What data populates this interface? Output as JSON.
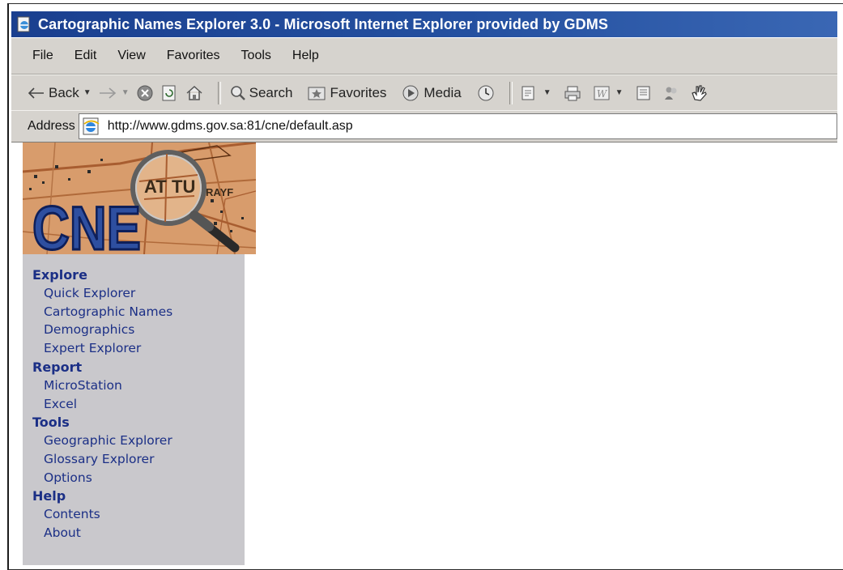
{
  "window": {
    "title": "Cartographic Names Explorer 3.0 - Microsoft Internet Explorer provided by GDMS",
    "app_icon": "ie-page-icon"
  },
  "menubar": {
    "items": [
      "File",
      "Edit",
      "View",
      "Favorites",
      "Tools",
      "Help"
    ]
  },
  "toolbar": {
    "back_label": "Back",
    "search_label": "Search",
    "favorites_label": "Favorites",
    "media_label": "Media",
    "icons": [
      "back-arrow-icon",
      "forward-arrow-icon",
      "stop-icon",
      "refresh-icon",
      "home-icon",
      "search-icon",
      "favorites-icon",
      "media-icon",
      "history-icon",
      "mail-icon",
      "print-icon",
      "edit-word-icon",
      "discuss-icon",
      "messenger-icon",
      "hand-icon"
    ]
  },
  "addressbar": {
    "label": "Address",
    "url": "http://www.gdms.gov.sa:81/cne/default.asp"
  },
  "logo": {
    "text": "CNE",
    "map_text_1": "AT",
    "map_text_2": "TU",
    "map_text_3": "RAYF",
    "colors": {
      "map": "#d89c6c",
      "letters": "#2e4fa0",
      "letters_outline": "#0e1f5a"
    }
  },
  "sidebar": {
    "background": "#c9c8cc",
    "link_color": "#1b2f86",
    "groups": [
      {
        "heading": "Explore",
        "links": [
          "Quick Explorer",
          "Cartographic Names",
          "Demographics",
          "Expert Explorer"
        ]
      },
      {
        "heading": "Report",
        "links": [
          "MicroStation",
          "Excel"
        ]
      },
      {
        "heading": "Tools",
        "links": [
          "Geographic Explorer",
          "Glossary Explorer",
          "Options"
        ]
      },
      {
        "heading": "Help",
        "links": [
          "Contents",
          "About"
        ]
      }
    ]
  }
}
